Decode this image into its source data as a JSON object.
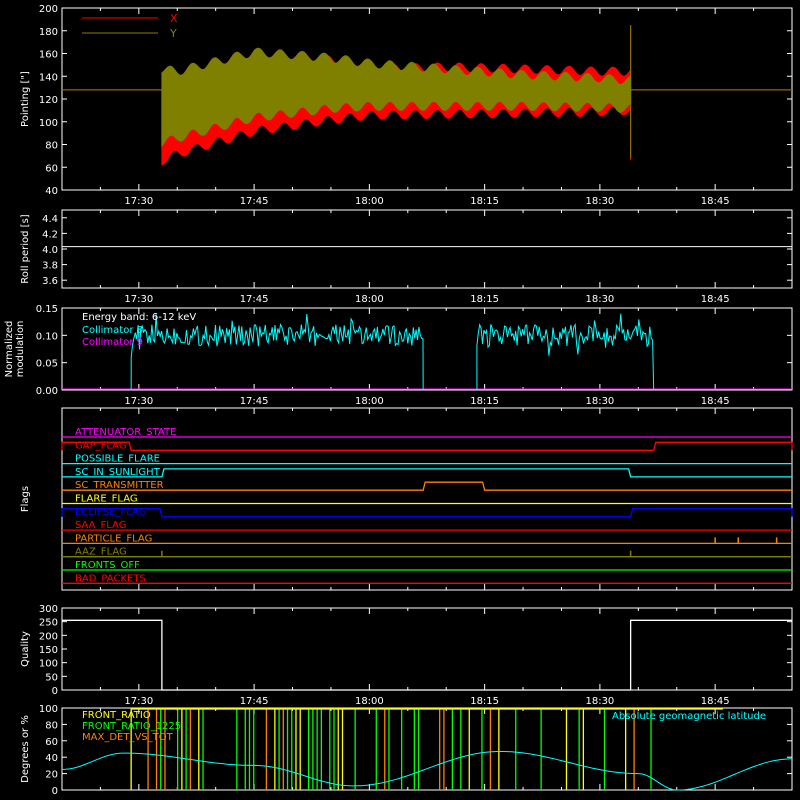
{
  "colors": {
    "bg": "#000000",
    "axis": "#ffffff",
    "red": "#ff0000",
    "olive": "#808000",
    "cyan": "#00ffff",
    "magenta": "#ff00ff",
    "yellow": "#ffff00",
    "green": "#00ff00",
    "orange": "#ff8000",
    "blue": "#0000ff"
  },
  "time_axis": {
    "tick_labels": [
      "17:30",
      "17:45",
      "18:00",
      "18:15",
      "18:30",
      "18:45"
    ],
    "tick_times": [
      "17:30",
      "17:45",
      "18:00",
      "18:15",
      "18:30",
      "18:45"
    ],
    "range": [
      "17:20",
      "18:55"
    ]
  },
  "chart_data": [
    {
      "id": "pointing",
      "type": "line",
      "ylabel": "Pointing [\"]",
      "ylim": [
        40,
        200
      ],
      "yticks": [
        "40",
        "60",
        "80",
        "100",
        "120",
        "140",
        "160",
        "180",
        "200"
      ],
      "legend": [
        "X",
        "Y"
      ],
      "series": [
        {
          "name": "X",
          "color": "#ff0000",
          "baseline": 128,
          "active": [
            "17:33",
            "18:34"
          ],
          "envelope_time": [
            "17:33",
            "17:35",
            "17:45",
            "17:55",
            "18:00",
            "18:10",
            "18:20",
            "18:30",
            "18:34"
          ],
          "envelope_max": [
            135,
            140,
            158,
            158,
            150,
            152,
            150,
            148,
            148
          ],
          "envelope_min": [
            62,
            68,
            88,
            98,
            102,
            103,
            104,
            105,
            106
          ]
        },
        {
          "name": "Y",
          "color": "#808000",
          "baseline": 128,
          "active": [
            "17:33",
            "18:34"
          ],
          "envelope_time": [
            "17:33",
            "17:35",
            "17:45",
            "17:55",
            "18:00",
            "18:10",
            "18:20",
            "18:30",
            "18:34"
          ],
          "envelope_max": [
            150,
            148,
            165,
            160,
            155,
            150,
            145,
            142,
            140
          ],
          "envelope_min": [
            78,
            82,
            100,
            108,
            110,
            110,
            110,
            109,
            108
          ]
        }
      ]
    },
    {
      "id": "roll",
      "type": "line",
      "ylabel": "Roll period [s]",
      "ylim": [
        3.5,
        4.5
      ],
      "yticks": [
        "3.6",
        "3.8",
        "4.0",
        "4.2",
        "4.4"
      ],
      "series": [
        {
          "name": "",
          "color": "#ffffff",
          "value": 4.03
        }
      ]
    },
    {
      "id": "modulation",
      "type": "line",
      "ylabel": "Normalized modulation",
      "ylim": [
        0,
        0.15
      ],
      "yticks": [
        "0.00",
        "0.05",
        "0.10",
        "0.15"
      ],
      "annotation": "Energy band: 6-12 keV",
      "legend": [
        "Collimator 8",
        "Collimator 9"
      ],
      "series": [
        {
          "name": "Collimator 8",
          "color": "#00ffff",
          "segments": [
            [
              "17:29",
              "18:07"
            ],
            [
              "18:14",
              "18:37"
            ]
          ],
          "mean": 0.1,
          "spread": 0.02
        },
        {
          "name": "Collimator 9",
          "color": "#ff00ff",
          "value": 0
        }
      ]
    },
    {
      "id": "flags",
      "type": "line",
      "ylabel": "Flags",
      "series": [
        {
          "name": "ATTENUATOR_STATE",
          "color": "#ff00ff",
          "raised": []
        },
        {
          "name": "GAP_FLAG",
          "color": "#ff0000",
          "raised": [
            [
              "17:20",
              "17:29"
            ],
            [
              "18:37",
              "18:55"
            ]
          ]
        },
        {
          "name": "POSSIBLE_FLARE",
          "color": "#00ffff",
          "raised": []
        },
        {
          "name": "SC_IN_SUNLIGHT",
          "color": "#00ffff",
          "raised": [
            [
              "17:33",
              "18:34"
            ]
          ]
        },
        {
          "name": "SC_TRANSMITTER",
          "color": "#ff8000",
          "raised": [
            [
              "18:07",
              "18:15"
            ]
          ]
        },
        {
          "name": "FLARE_FLAG",
          "color": "#ffff00",
          "raised": []
        },
        {
          "name": "ECLIPSE_FLAG",
          "color": "#0000ff",
          "raised": [
            [
              "17:20",
              "17:33"
            ],
            [
              "18:34",
              "18:55"
            ]
          ]
        },
        {
          "name": "SAA_FLAG",
          "color": "#ff0000",
          "raised": []
        },
        {
          "name": "PARTICLE_FLAG",
          "color": "#ff8000",
          "raised": [],
          "spikes": [
            "18:45",
            "18:48",
            "18:53"
          ]
        },
        {
          "name": "AAZ_FLAG",
          "color": "#808000",
          "raised": [],
          "spikes": [
            "17:33",
            "18:34"
          ]
        },
        {
          "name": "FRONTS_OFF",
          "color": "#00ff00",
          "raised": []
        },
        {
          "name": "BAD_PACKETS",
          "color": "#ff0000",
          "raised": []
        }
      ]
    },
    {
      "id": "quality",
      "type": "line",
      "ylabel": "Quality",
      "ylim": [
        0,
        300
      ],
      "yticks": [
        "0",
        "50",
        "100",
        "150",
        "200",
        "250",
        "300"
      ],
      "series": [
        {
          "name": "",
          "color": "#ffffff",
          "x": [
            "17:20",
            "17:33",
            "17:33",
            "18:34",
            "18:34",
            "18:55"
          ],
          "y": [
            255,
            255,
            0,
            0,
            255,
            255
          ]
        }
      ]
    },
    {
      "id": "geomag",
      "type": "line",
      "ylabel": "Degrees or %",
      "ylim": [
        0,
        100
      ],
      "yticks": [
        "0",
        "20",
        "40",
        "60",
        "80",
        "100"
      ],
      "legend_left": [
        "FRONT_RATIO",
        "FRONT_RATIO_1225",
        "MAX_DET_VS_TOT"
      ],
      "legend_right": "Absolute geomagnetic latitude",
      "bar_range": [
        "17:29",
        "18:38"
      ],
      "series": [
        {
          "name": "Absolute geomagnetic latitude",
          "color": "#00ffff",
          "x": [
            "17:20",
            "17:28",
            "17:45",
            "17:58",
            "18:17",
            "18:35",
            "18:40",
            "18:55"
          ],
          "y": [
            25,
            45,
            30,
            5,
            47,
            20,
            0,
            38
          ]
        },
        {
          "name": "FRONT_RATIO",
          "color": "#ffff00"
        },
        {
          "name": "FRONT_RATIO_1225",
          "color": "#00ff00"
        },
        {
          "name": "MAX_DET_VS_TOT",
          "color": "#ff8000"
        }
      ]
    }
  ]
}
